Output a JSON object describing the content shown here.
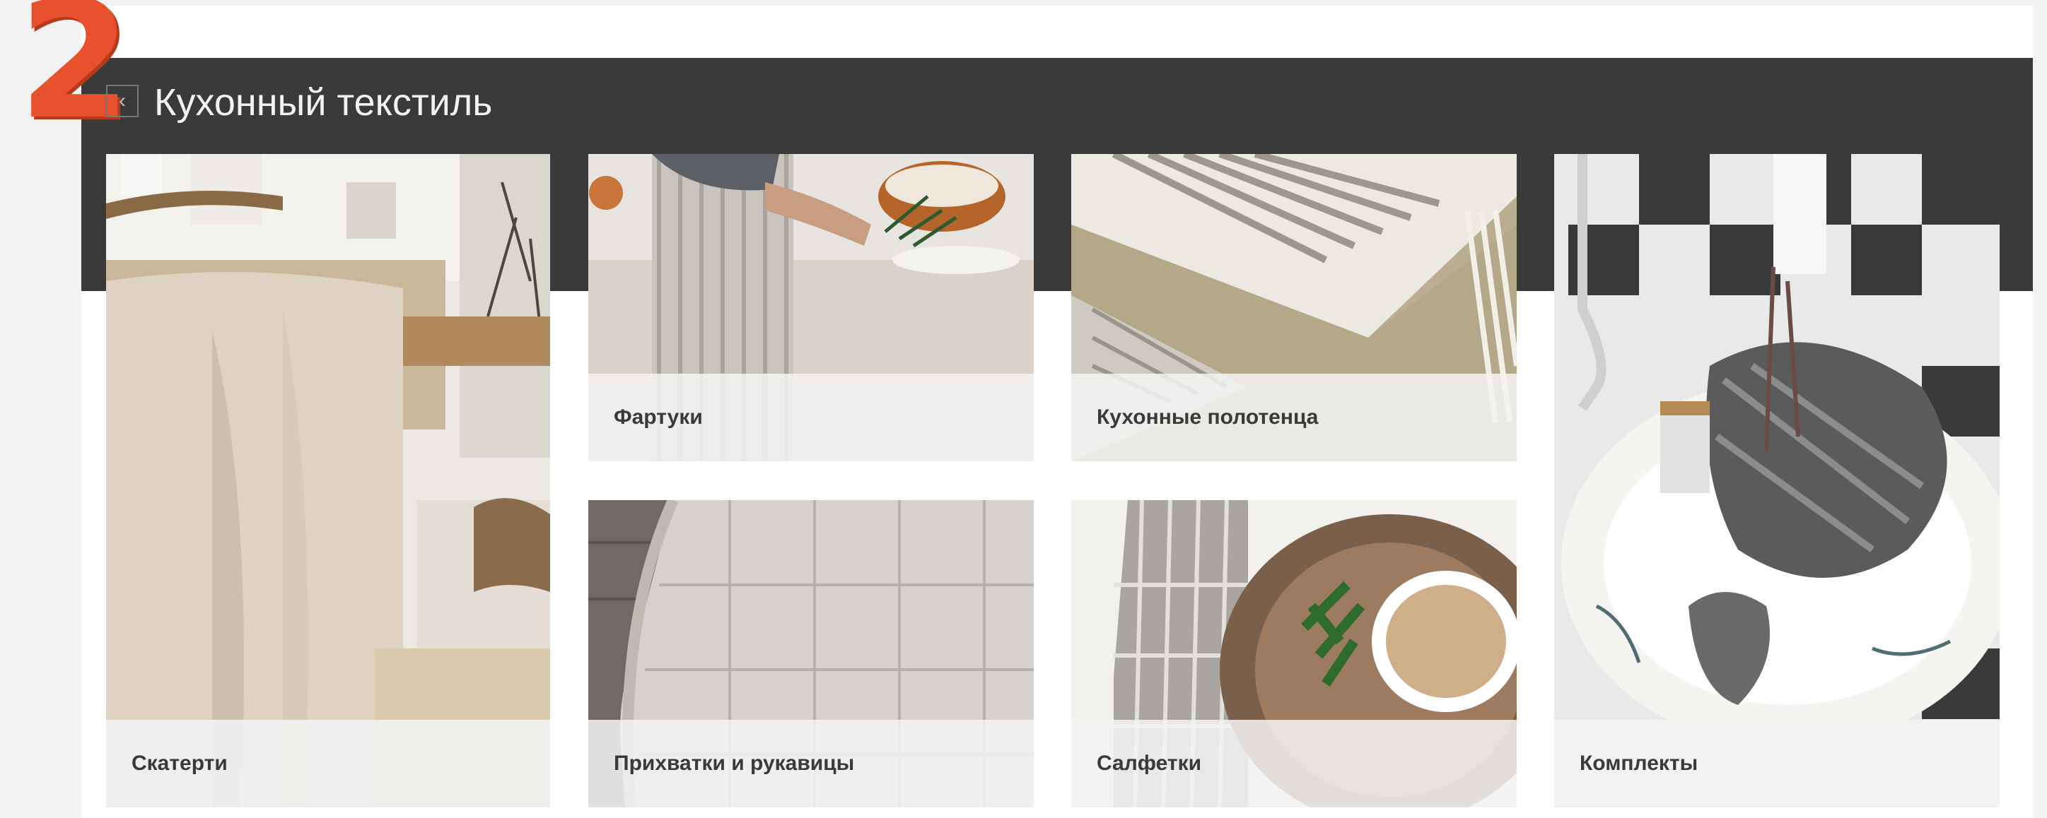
{
  "badge": {
    "number": "2",
    "color": "#e8512e"
  },
  "header": {
    "title": "Кухонный текстиль",
    "back_icon": "chevron-left-icon"
  },
  "categories": [
    {
      "label": "Скатерти"
    },
    {
      "label": "Фартуки"
    },
    {
      "label": "Кухонные полотенца"
    },
    {
      "label": "Комплекты"
    },
    {
      "label": "Прихватки и рукавицы"
    },
    {
      "label": "Салфетки"
    }
  ]
}
